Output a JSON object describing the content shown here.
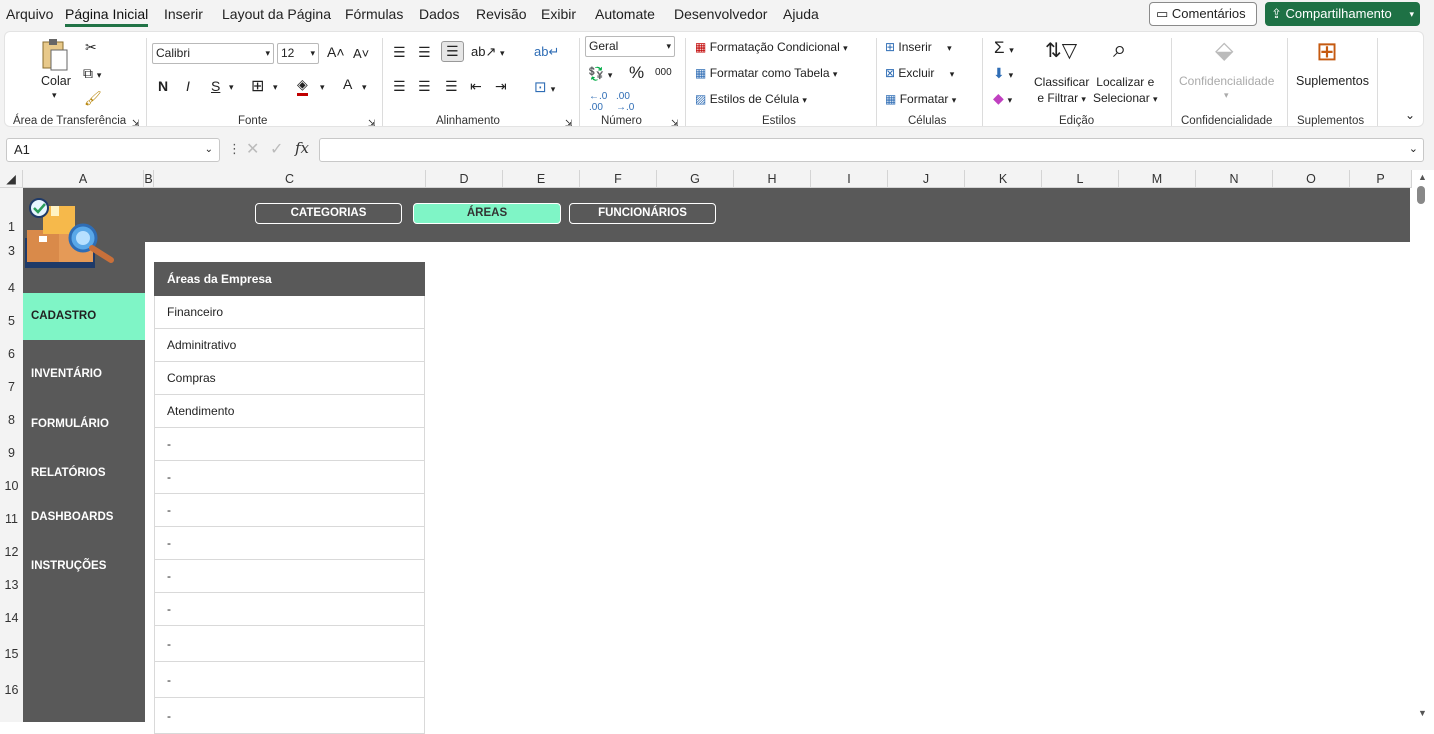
{
  "menu": {
    "tabs": [
      "Arquivo",
      "Página Inicial",
      "Inserir",
      "Layout da Página",
      "Fórmulas",
      "Dados",
      "Revisão",
      "Exibir",
      "Automate",
      "Desenvolvedor",
      "Ajuda"
    ],
    "comments": "Comentários",
    "share": "Compartilhamento"
  },
  "ribbon": {
    "clipboard": {
      "paste": "Colar",
      "label": "Área de Transferência"
    },
    "font": {
      "name": "Calibri",
      "size": "12",
      "label": "Fonte",
      "bold": "N",
      "italic": "I",
      "underline": "S"
    },
    "alignment": {
      "label": "Alinhamento"
    },
    "number": {
      "format": "Geral",
      "label": "Número"
    },
    "styles": {
      "conditional": "Formatação Condicional",
      "as_table": "Formatar como Tabela",
      "cell_styles": "Estilos de Célula",
      "label": "Estilos"
    },
    "cells": {
      "insert": "Inserir",
      "delete": "Excluir",
      "format": "Formatar",
      "label": "Células"
    },
    "editing": {
      "sort_l1": "Classificar",
      "sort_l2": "e Filtrar",
      "find_l1": "Localizar e",
      "find_l2": "Selecionar",
      "label": "Edição"
    },
    "confidential": {
      "button": "Confidencialidade",
      "label": "Confidencialidade"
    },
    "addins": {
      "button": "Suplementos",
      "label": "Suplementos"
    }
  },
  "formula_bar": {
    "name_box": "A1",
    "formula": ""
  },
  "columns": [
    "A",
    "B",
    "C",
    "D",
    "E",
    "F",
    "G",
    "H",
    "I",
    "J",
    "K",
    "L",
    "M",
    "N",
    "O",
    "P"
  ],
  "rows": [
    "1",
    "3",
    "4",
    "5",
    "6",
    "7",
    "8",
    "9",
    "10",
    "11",
    "12",
    "13",
    "14",
    "15",
    "16"
  ],
  "nav_buttons": [
    "CATEGORIAS",
    "ÁREAS",
    "FUNCIONÁRIOS"
  ],
  "sidebar": [
    "CADASTRO",
    "INVENTÁRIO",
    "FORMULÁRIO",
    "RELATÓRIOS",
    "DASHBOARDS",
    "INSTRUÇÕES"
  ],
  "table": {
    "header": "Áreas da Empresa",
    "rows": [
      "Financeiro",
      "Adminitrativo",
      "Compras",
      "Atendimento",
      "-",
      "-",
      "-",
      "-",
      "-",
      "-",
      "-",
      "-",
      "-"
    ]
  },
  "colors": {
    "accent": "#7ff5c6",
    "band": "#595959",
    "excel_green": "#1e7145"
  }
}
